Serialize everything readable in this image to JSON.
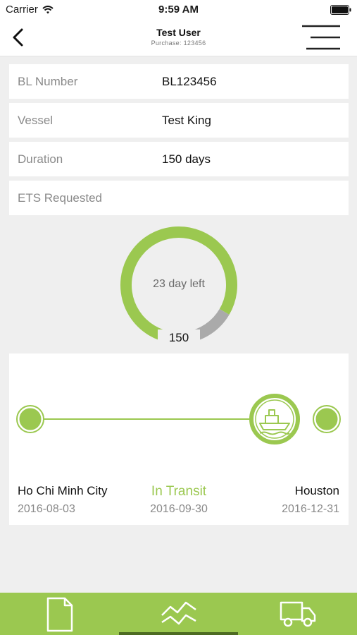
{
  "status_bar": {
    "carrier": "Carrier",
    "time": "9:59 AM"
  },
  "header": {
    "title": "Test User",
    "subtitle": "Purchase: 123456"
  },
  "details": [
    {
      "label": "BL Number",
      "value": "BL123456"
    },
    {
      "label": "Vessel",
      "value": "Test King"
    },
    {
      "label": "Duration",
      "value": "150 days"
    },
    {
      "label": "ETS Requested",
      "value": ""
    }
  ],
  "progress": {
    "center_text": "23 day left",
    "total_label": "150",
    "elapsed_fraction": 0.85,
    "colors": {
      "elapsed": "#9bc850",
      "remaining": "#aaaaaa"
    }
  },
  "route": {
    "origin": {
      "name": "Ho Chi Minh City",
      "date": "2016-08-03"
    },
    "status": {
      "label": "In Transit",
      "date": "2016-09-30"
    },
    "destination": {
      "name": "Houston",
      "date": "2016-12-31"
    }
  },
  "tab_bar": {
    "tabs": [
      {
        "icon": "document-icon"
      },
      {
        "icon": "tracking-chart-icon",
        "active": true
      },
      {
        "icon": "truck-icon"
      }
    ]
  },
  "theme": {
    "accent": "#9bc850",
    "accent_dark": "#4d6b22"
  }
}
